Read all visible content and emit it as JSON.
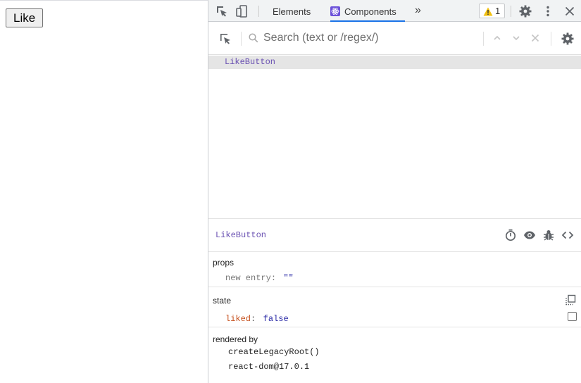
{
  "page": {
    "button_label": "Like"
  },
  "devtools": {
    "tabs": [
      {
        "label": "Elements",
        "active": false
      },
      {
        "label": "Components",
        "active": true
      }
    ],
    "more_tabs_glyph": "»",
    "warnings_count": "1",
    "search_placeholder": "Search (text or /regex/)",
    "tree": [
      {
        "label": "LikeButton",
        "selected": true
      }
    ],
    "inspector": {
      "component_name": "LikeButton",
      "props_title": "props",
      "props": [
        {
          "key": "new entry",
          "value": "\"\""
        }
      ],
      "state_title": "state",
      "state": [
        {
          "key": "liked",
          "value": "false",
          "checked": false
        }
      ],
      "rendered_by_title": "rendered by",
      "rendered_by": [
        "createLegacyRoot()",
        "react-dom@17.0.1"
      ]
    },
    "colors": {
      "accent": "#1a73e8",
      "component_name": "#6a51b2",
      "state_key": "#c6501d",
      "value_blue": "#2a2aa6",
      "warning": "#f2c00e"
    }
  }
}
